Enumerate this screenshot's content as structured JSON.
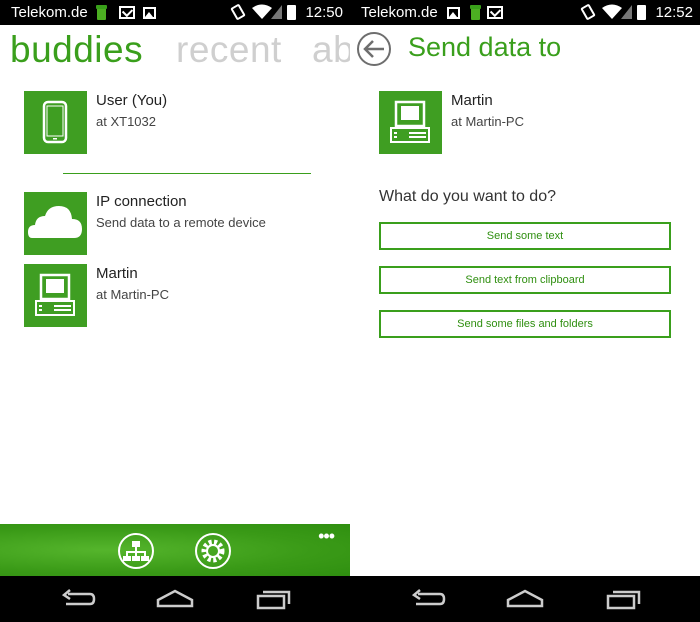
{
  "status_bars": [
    {
      "carrier": "Telekom.de",
      "time": "12:50"
    },
    {
      "carrier": "Telekom.de",
      "time": "12:52"
    }
  ],
  "left": {
    "tabs": [
      {
        "label": "buddies"
      },
      {
        "label": "recent"
      },
      {
        "label": "ab"
      }
    ],
    "buddies": [
      {
        "name": "User (You)",
        "location": "at XT1032",
        "icon": "smartphone-icon"
      },
      {
        "name": "IP connection",
        "location": "Send data to a remote device",
        "icon": "cloud-icon"
      },
      {
        "name": "Martin",
        "location": "at Martin-PC",
        "icon": "computer-icon"
      }
    ],
    "bottom_bar": {
      "buttons": [
        {
          "icon": "network-icon"
        },
        {
          "icon": "settings-gear-icon"
        }
      ],
      "more_label": "•••"
    }
  },
  "right": {
    "title": "Send data to",
    "target": {
      "name": "Martin",
      "location": "at Martin-PC",
      "icon": "computer-icon"
    },
    "question": "What do you want to do?",
    "actions": [
      {
        "label": "Send some text"
      },
      {
        "label": "Send text from clipboard"
      },
      {
        "label": "Send some files and folders"
      }
    ]
  },
  "colors": {
    "accent": "#3a9f1c",
    "tile": "#3f9e22",
    "inactive_tab": "#cfcfcf"
  }
}
